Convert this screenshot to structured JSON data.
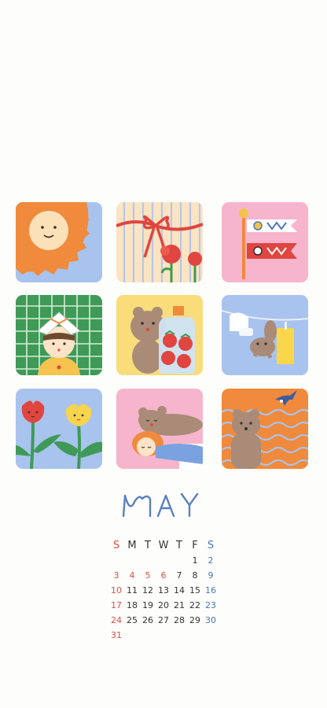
{
  "month": "MAY",
  "weekdays": [
    "S",
    "M",
    "T",
    "W",
    "T",
    "F",
    "S"
  ],
  "weeks": [
    [
      "",
      "",
      "",
      "",
      "",
      "1",
      "2"
    ],
    [
      "3",
      "4",
      "5",
      "6",
      "7",
      "8",
      "9"
    ],
    [
      "10",
      "11",
      "12",
      "13",
      "14",
      "15",
      "16"
    ],
    [
      "17",
      "18",
      "19",
      "20",
      "21",
      "22",
      "23"
    ],
    [
      "24",
      "25",
      "26",
      "27",
      "28",
      "29",
      "30"
    ],
    [
      "31",
      "",
      "",
      "",
      "",
      "",
      ""
    ]
  ],
  "colors": {
    "sunday": "#d9504a",
    "saturday": "#4a78b8",
    "holiday": "#d9504a",
    "month_title": "#5a7fc2",
    "background": "#fdfdfb"
  },
  "holidays": [
    "4",
    "5",
    "6"
  ],
  "tiles": [
    {
      "icon": "sun-icon"
    },
    {
      "icon": "gift-ribbon-carnation-icon"
    },
    {
      "icon": "koinobori-carp-streamer-icon"
    },
    {
      "icon": "child-paper-helmet-icon"
    },
    {
      "icon": "bear-strawberry-jar-icon"
    },
    {
      "icon": "bear-laundry-line-icon"
    },
    {
      "icon": "tulips-icon"
    },
    {
      "icon": "sleeping-bear-girl-icon"
    },
    {
      "icon": "bear-swallow-waves-icon"
    }
  ]
}
